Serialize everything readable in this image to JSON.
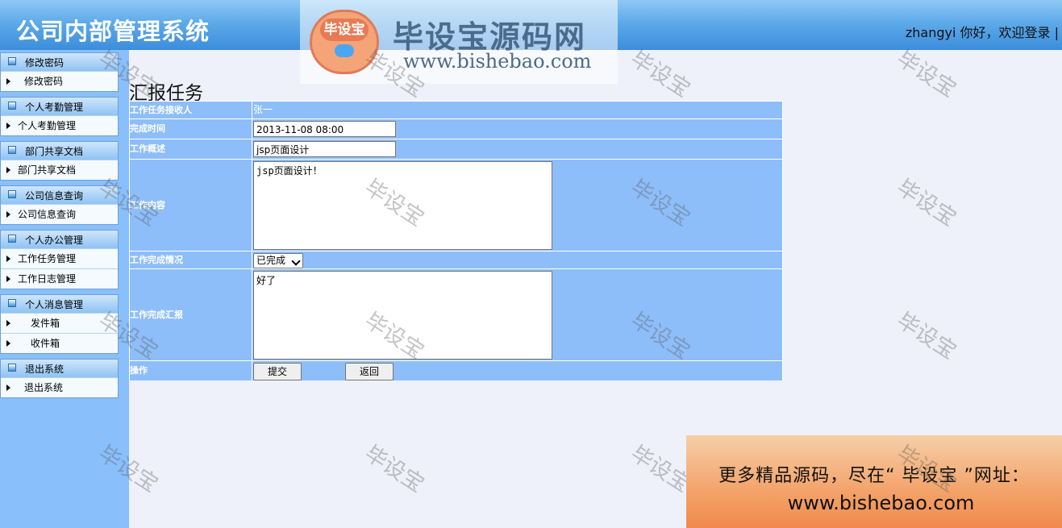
{
  "header": {
    "title": "公司内部管理系统",
    "welcome": "zhangyi 你好，欢迎登录 |"
  },
  "logo_watermark": {
    "badge_text": "毕设宝",
    "name": "毕设宝源码网",
    "url": "www.bishebao.com"
  },
  "sidebar": {
    "groups": [
      {
        "title": "修改密码",
        "items": [
          "修改密码"
        ]
      },
      {
        "title": "个人考勤管理",
        "items": [
          "个人考勤管理"
        ]
      },
      {
        "title": "部门共享文档",
        "items": [
          "部门共享文档"
        ]
      },
      {
        "title": "公司信息查询",
        "items": [
          "公司信息查询"
        ]
      },
      {
        "title": "个人办公管理",
        "items": [
          "工作任务管理",
          "工作日志管理"
        ]
      },
      {
        "title": "个人消息管理",
        "items": [
          "发件箱",
          "收件箱"
        ]
      },
      {
        "title": "退出系统",
        "items": [
          "退出系统"
        ]
      }
    ]
  },
  "page": {
    "title": "汇报任务"
  },
  "form": {
    "receiver_label": "工作任务接收人",
    "receiver_value": "张一",
    "time_label": "完成时间",
    "time_value": "2013-11-08 08:00",
    "summary_label": "工作概述",
    "summary_value": "jsp页面设计",
    "content_label": "工作内容",
    "content_value": "jsp页面设计！",
    "status_label": "工作完成情况",
    "status_value": "已完成",
    "report_label": "工作完成汇报",
    "report_value": "好了",
    "action_label": "操作",
    "submit_label": "提交",
    "back_label": "返回"
  },
  "watermark": {
    "text": "毕设宝"
  },
  "promo": {
    "line1": "更多精品源码，尽在“ 毕设宝 ”网址：",
    "line2": "www.bishebao.com"
  }
}
